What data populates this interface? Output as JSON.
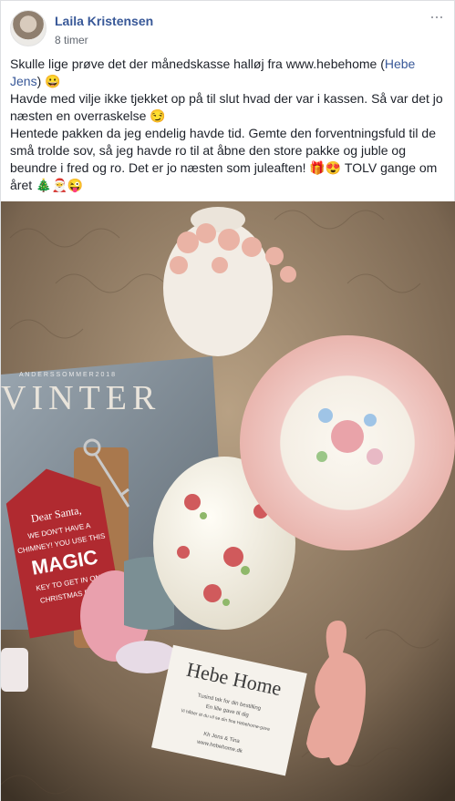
{
  "post": {
    "author": "Laila Kristensen",
    "timestamp": "8 timer",
    "more_icon": "more-horizontal-icon",
    "line1": "Skulle lige prøve det der månedskasse halløj fra www.hebehome (",
    "mention": "Hebe Jens",
    "line1_end": ") 😀",
    "line2": "Havde med vilje ikke tjekket op på til slut hvad der var i kassen. Så var det jo næsten en overraskelse 😏",
    "line3": "Hentede pakken da jeg endelig havde tid. Gemte den forventningsfuld til de små trolde sov, så jeg havde ro til at åbne den store pakke og juble og beundre i fred og ro. Det er jo næsten som juleaften! 🎁😍 TOLV gange om året 🎄🎅😜"
  },
  "photo": {
    "book_title": "VINTER",
    "book_top_line": "A N D E R S   S O M M E R   2 0 1 8",
    "tag_line1": "Dear Santa,",
    "tag_line2": "WE DON'T HAVE A",
    "tag_line3": "CHIMNEY! YOU USE THIS",
    "tag_line4": "MAGIC",
    "tag_line5": "KEY TO GET IN ON",
    "tag_line6": "CHRISTMAS EVE!",
    "card_title": "Hebe Home",
    "card_line1": "Tusind tak for din bestilling",
    "card_line2": "En lille gave til dig",
    "card_line3": "Vi håber at du vil se din fine Hebehome-gave",
    "card_sign": "Kh Jens & Tina",
    "card_web": "www.hebehome.dk"
  }
}
